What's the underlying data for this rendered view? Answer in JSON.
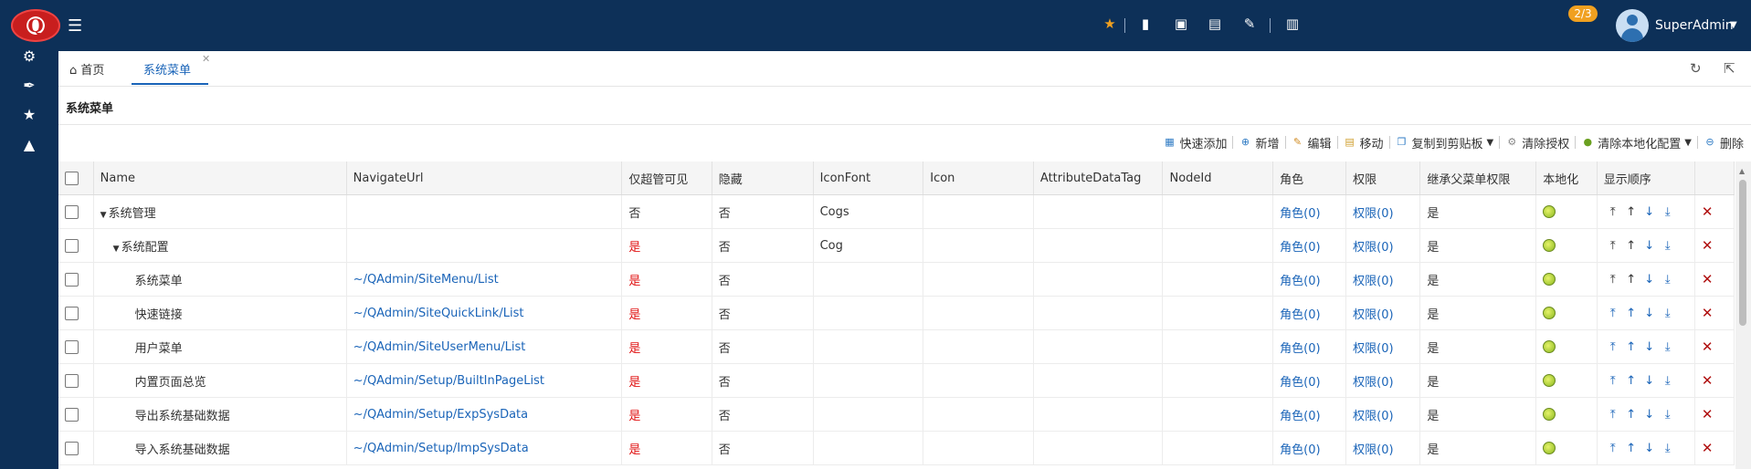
{
  "header": {
    "logo_text": "Q",
    "badge": "2/3",
    "user_name": "SuperAdmin"
  },
  "tabs": [
    {
      "label": "首页",
      "icon": "home-icon"
    },
    {
      "label": "系统菜单"
    }
  ],
  "panel": {
    "title": "系统菜单"
  },
  "toolbar": {
    "quick_add": "快速添加",
    "add": "新增",
    "edit": "编辑",
    "move": "移动",
    "copy_clipboard": "复制到剪贴板",
    "clear_auth": "清除授权",
    "clear_local": "清除本地化配置",
    "delete": "删除"
  },
  "columns": [
    "Name",
    "NavigateUrl",
    "仅超管可见",
    "隐藏",
    "IconFont",
    "Icon",
    "AttributeDataTag",
    "NodeId",
    "角色",
    "权限",
    "继承父菜单权限",
    "本地化",
    "显示顺序"
  ],
  "rows": [
    {
      "name": "系统管理",
      "level": 0,
      "expand": true,
      "url": "",
      "super": "否",
      "hidden": "否",
      "iconfont": "Cogs",
      "role": "角色(0)",
      "perm": "权限(0)",
      "inherit": "是"
    },
    {
      "name": "系统配置",
      "level": 1,
      "expand": true,
      "url": "",
      "super": "是",
      "hidden": "否",
      "iconfont": "Cog",
      "role": "角色(0)",
      "perm": "权限(0)",
      "inherit": "是"
    },
    {
      "name": "系统菜单",
      "level": 2,
      "expand": false,
      "url": "~/QAdmin/SiteMenu/List",
      "super": "是",
      "hidden": "否",
      "iconfont": "",
      "role": "角色(0)",
      "perm": "权限(0)",
      "inherit": "是"
    },
    {
      "name": "快速链接",
      "level": 2,
      "expand": false,
      "url": "~/QAdmin/SiteQuickLink/List",
      "super": "是",
      "hidden": "否",
      "iconfont": "",
      "role": "角色(0)",
      "perm": "权限(0)",
      "inherit": "是"
    },
    {
      "name": "用户菜单",
      "level": 2,
      "expand": false,
      "url": "~/QAdmin/SiteUserMenu/List",
      "super": "是",
      "hidden": "否",
      "iconfont": "",
      "role": "角色(0)",
      "perm": "权限(0)",
      "inherit": "是"
    },
    {
      "name": "内置页面总览",
      "level": 2,
      "expand": false,
      "url": "~/QAdmin/Setup/BuiltInPageList",
      "super": "是",
      "hidden": "否",
      "iconfont": "",
      "role": "角色(0)",
      "perm": "权限(0)",
      "inherit": "是"
    },
    {
      "name": "导出系统基础数据",
      "level": 2,
      "expand": false,
      "url": "~/QAdmin/Setup/ExpSysData",
      "super": "是",
      "hidden": "否",
      "iconfont": "",
      "role": "角色(0)",
      "perm": "权限(0)",
      "inherit": "是"
    },
    {
      "name": "导入系统基础数据",
      "level": 2,
      "expand": false,
      "url": "~/QAdmin/Setup/ImpSysData",
      "super": "是",
      "hidden": "否",
      "iconfont": "",
      "role": "角色(0)",
      "perm": "权限(0)",
      "inherit": "是"
    }
  ],
  "order_icons": [
    "move-top-icon",
    "move-up-icon",
    "move-down-icon",
    "move-bottom-icon"
  ]
}
